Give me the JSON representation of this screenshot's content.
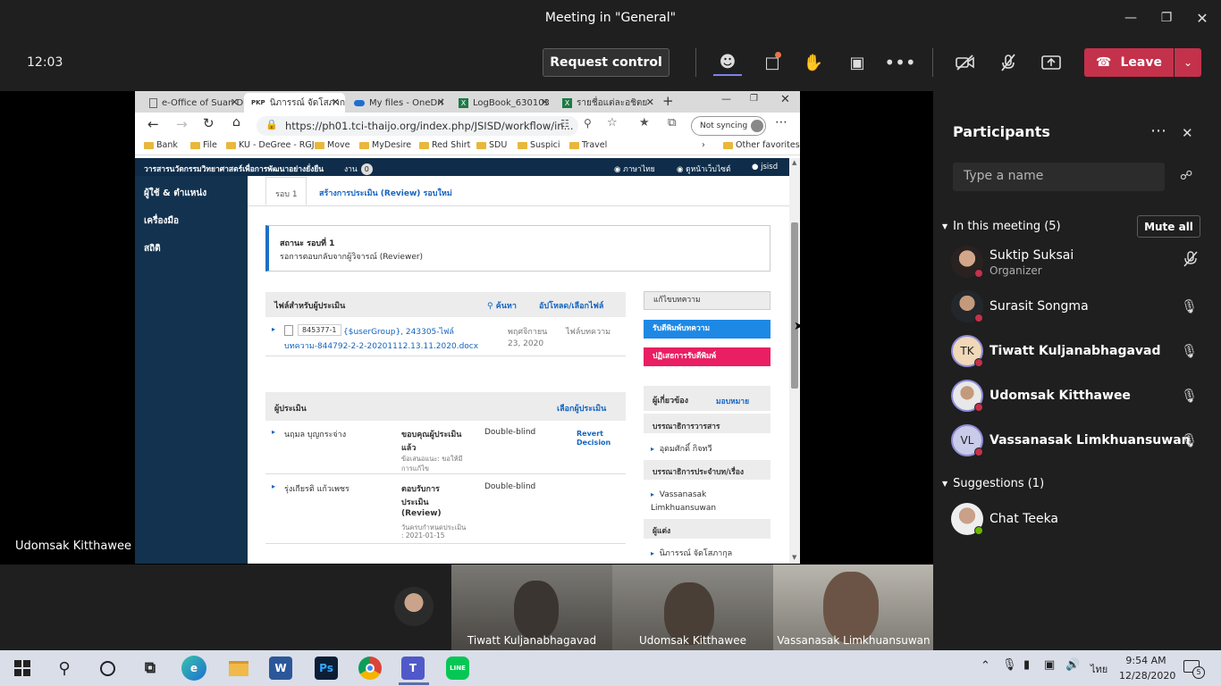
{
  "teams": {
    "window_title": "Meeting in \"General\"",
    "clock": "12:03",
    "request_control": "Request control",
    "leave": "Leave",
    "shared_screen_owner": "Udomsak Kitthawee"
  },
  "browser": {
    "tabs": [
      {
        "label": "e-Office of Suan D",
        "icon": "page-icon"
      },
      {
        "label": "นิภารรณ์ จัดโสภาก",
        "icon": "pkp-icon"
      },
      {
        "label": "My files - OneDri",
        "icon": "onedrive-icon"
      },
      {
        "label": "LogBook_630103",
        "icon": "excel-icon"
      },
      {
        "label": "รายชื่อแต่ละอชิตย",
        "icon": "excel-icon"
      }
    ],
    "url": "https://ph01.tci-thaijo.org/index.php/JSISD/workflow/in...",
    "sync": "Not syncing",
    "favorites": [
      "Bank",
      "File",
      "KU - DeGree - RGJ",
      "Move",
      "MyDesire",
      "Red Shirt",
      "SDU",
      "Suspici",
      "Travel"
    ],
    "other_favorites": "Other favorites"
  },
  "journal": {
    "header_title": "วารสารนวัตกรรมวิทยาศาสตร์เพื่อการพัฒนาอย่างยั่งยืน",
    "tasks_label": "งาน",
    "tasks_count": "0",
    "lang": "ภาษาไทย",
    "view_site": "ดูหน้าเว็บไซต์",
    "user": "jsisd",
    "sidebar": [
      "ผู้ใช้ & ตำแหน่ง",
      "เครื่องมือ",
      "สถิติ"
    ],
    "round_tab": "รอบ 1",
    "new_round_tab": "สร้างการประเมิน (Review) รอบใหม่",
    "status_title": "สถานะ รอบที่ 1",
    "status_text": "รอการตอบกลับจากผู้วิจารณ์ (Reviewer)",
    "files_title": "ไฟล์สำหรับผู้ประเมิน",
    "files_search": "ค้นหา",
    "files_upload": "อัปโหลด/เลือกไฟล์",
    "file": {
      "id": "845377-1",
      "name_line1": "{$userGroup}, 243305-ไฟล์",
      "name_line2": "บทความ-844792-2-2-20201112.13.11.2020.docx",
      "date_line1": "พฤศจิกายน",
      "date_line2": "23, 2020",
      "type": "ไฟล์บทความ"
    },
    "actions": [
      "แก้ไขบทความ",
      "รับตีพิมพ์บทความ",
      "ปฏิเสธการรับตีพิมพ์"
    ],
    "reviewers_title": "ผู้ประเมิน",
    "select_reviewer": "เลือกผู้ประเมิน",
    "reviewers": [
      {
        "name": "นฤมล บุญกระจ่าง",
        "status_l1": "ขอบคุณผู้ประเมิน",
        "status_l2": "แล้ว",
        "note_l1": "ข้อเสนอแนะ: ขอให้มี",
        "note_l2": "การแก้ไข",
        "method": "Double-blind",
        "action_l1": "Revert",
        "action_l2": "Decision"
      },
      {
        "name": "รุ่งเกียรติ แก้วเพชร",
        "status_l1": "ตอบรับการ",
        "status_l2": "ประเมิน",
        "status_l3": "(Review)",
        "note_l1": "วันครบกำหนดประเมิน",
        "note_l2": ": 2021-01-15",
        "method": "Double-blind"
      }
    ],
    "participants_title": "ผู้เกี่ยวข้อง",
    "assign": "มอบหมาย",
    "groups": [
      {
        "title": "บรรณาธิการวารสาร",
        "people": [
          "อุดมศักดิ์ กิจทวี"
        ]
      },
      {
        "title": "บรรณาธิการประจำบท/เรื่อง",
        "people": [
          "Vassanasak Limkhuansuwan"
        ]
      },
      {
        "title": "ผู้แต่ง",
        "people": [
          "นิภารรณ์ จัดโสภากุล"
        ]
      }
    ]
  },
  "gallery": [
    {
      "name": "Tiwatt Kuljanabhagavad"
    },
    {
      "name": "Udomsak Kitthawee"
    },
    {
      "name": "Vassanasak Limkhuansuwan"
    }
  ],
  "participants": {
    "title": "Participants",
    "search_placeholder": "Type a name",
    "in_meeting": "In this meeting (5)",
    "mute_all": "Mute all",
    "people": [
      {
        "name": "Suktip Suksai",
        "role": "Organizer",
        "initials": "",
        "bold": false,
        "status_color": "#c4314b",
        "mic": "mic-off-icon"
      },
      {
        "name": "Surasit Songma",
        "role": "",
        "initials": "",
        "bold": false,
        "status_color": "#c4314b",
        "mic": "mic-icon"
      },
      {
        "name": "Tiwatt Kuljanabhagavad",
        "role": "",
        "initials": "TK",
        "bold": true,
        "status_color": "#c4314b",
        "mic": "mic-icon"
      },
      {
        "name": "Udomsak Kitthawee",
        "role": "",
        "initials": "",
        "bold": true,
        "status_color": "#c4314b",
        "mic": "mic-icon"
      },
      {
        "name": "Vassanasak Limkhuansuwan",
        "role": "",
        "initials": "VL",
        "bold": true,
        "status_color": "#c4314b",
        "mic": "mic-icon"
      }
    ],
    "suggestions": "Suggestions (1)",
    "suggested": [
      {
        "name": "Chat Teeka",
        "status_color": "#6bb700"
      }
    ]
  },
  "taskbar": {
    "time": "9:54 AM",
    "date": "12/28/2020",
    "lang": "ไทย",
    "notifications": "5",
    "apps": [
      "windows-start-icon",
      "search-icon",
      "cortana-icon",
      "task-view-icon",
      "edge-icon",
      "file-explorer-icon",
      "word-icon",
      "photoshop-icon",
      "chrome-icon",
      "teams-icon",
      "line-icon"
    ]
  }
}
